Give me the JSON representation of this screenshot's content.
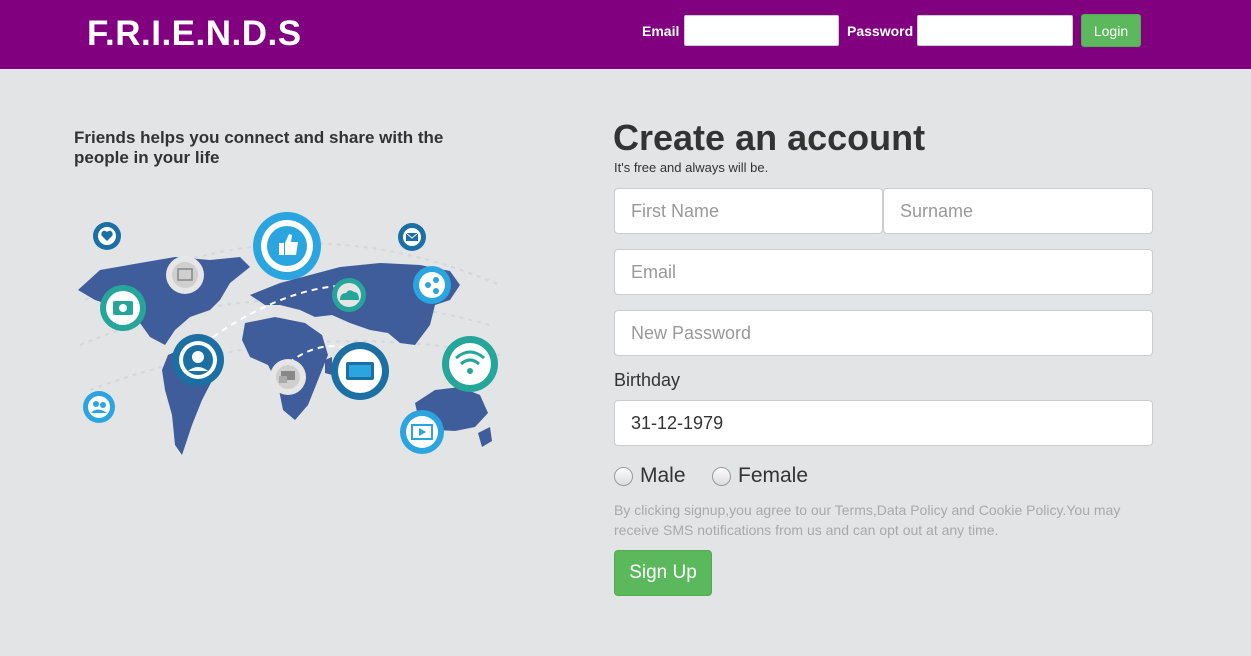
{
  "header": {
    "brand": "F.R.I.E.N.D.S",
    "email_label": "Email",
    "email_value": "",
    "password_label": "Password",
    "password_value": "",
    "login_label": "Login"
  },
  "hero": {
    "tagline": "Friends helps you connect and share with the people in your life"
  },
  "signup": {
    "title": "Create an account",
    "subtitle": "It's free and always will be.",
    "first_name_placeholder": "First Name",
    "surname_placeholder": "Surname",
    "email_placeholder": "Email",
    "password_placeholder": "New Password",
    "birthday_label": "Birthday",
    "birthday_value": "31-12-1979",
    "gender_options": [
      "Male",
      "Female"
    ],
    "terms": "By clicking signup,you agree to our Terms,Data Policy and Cookie Policy.You may receive SMS notifications from us and can opt out at any time.",
    "signup_label": "Sign Up"
  },
  "colors": {
    "header_bg": "#800080",
    "button_green": "#5cb85c",
    "page_bg": "#e3e4e6"
  },
  "icons": [
    "heart-icon",
    "photo-icon",
    "thumbs-up-icon",
    "mail-icon",
    "share-icon",
    "camera-icon",
    "cloud-icon",
    "headset-icon",
    "chat-icon",
    "monitor-icon",
    "wifi-icon",
    "users-icon",
    "video-icon"
  ]
}
